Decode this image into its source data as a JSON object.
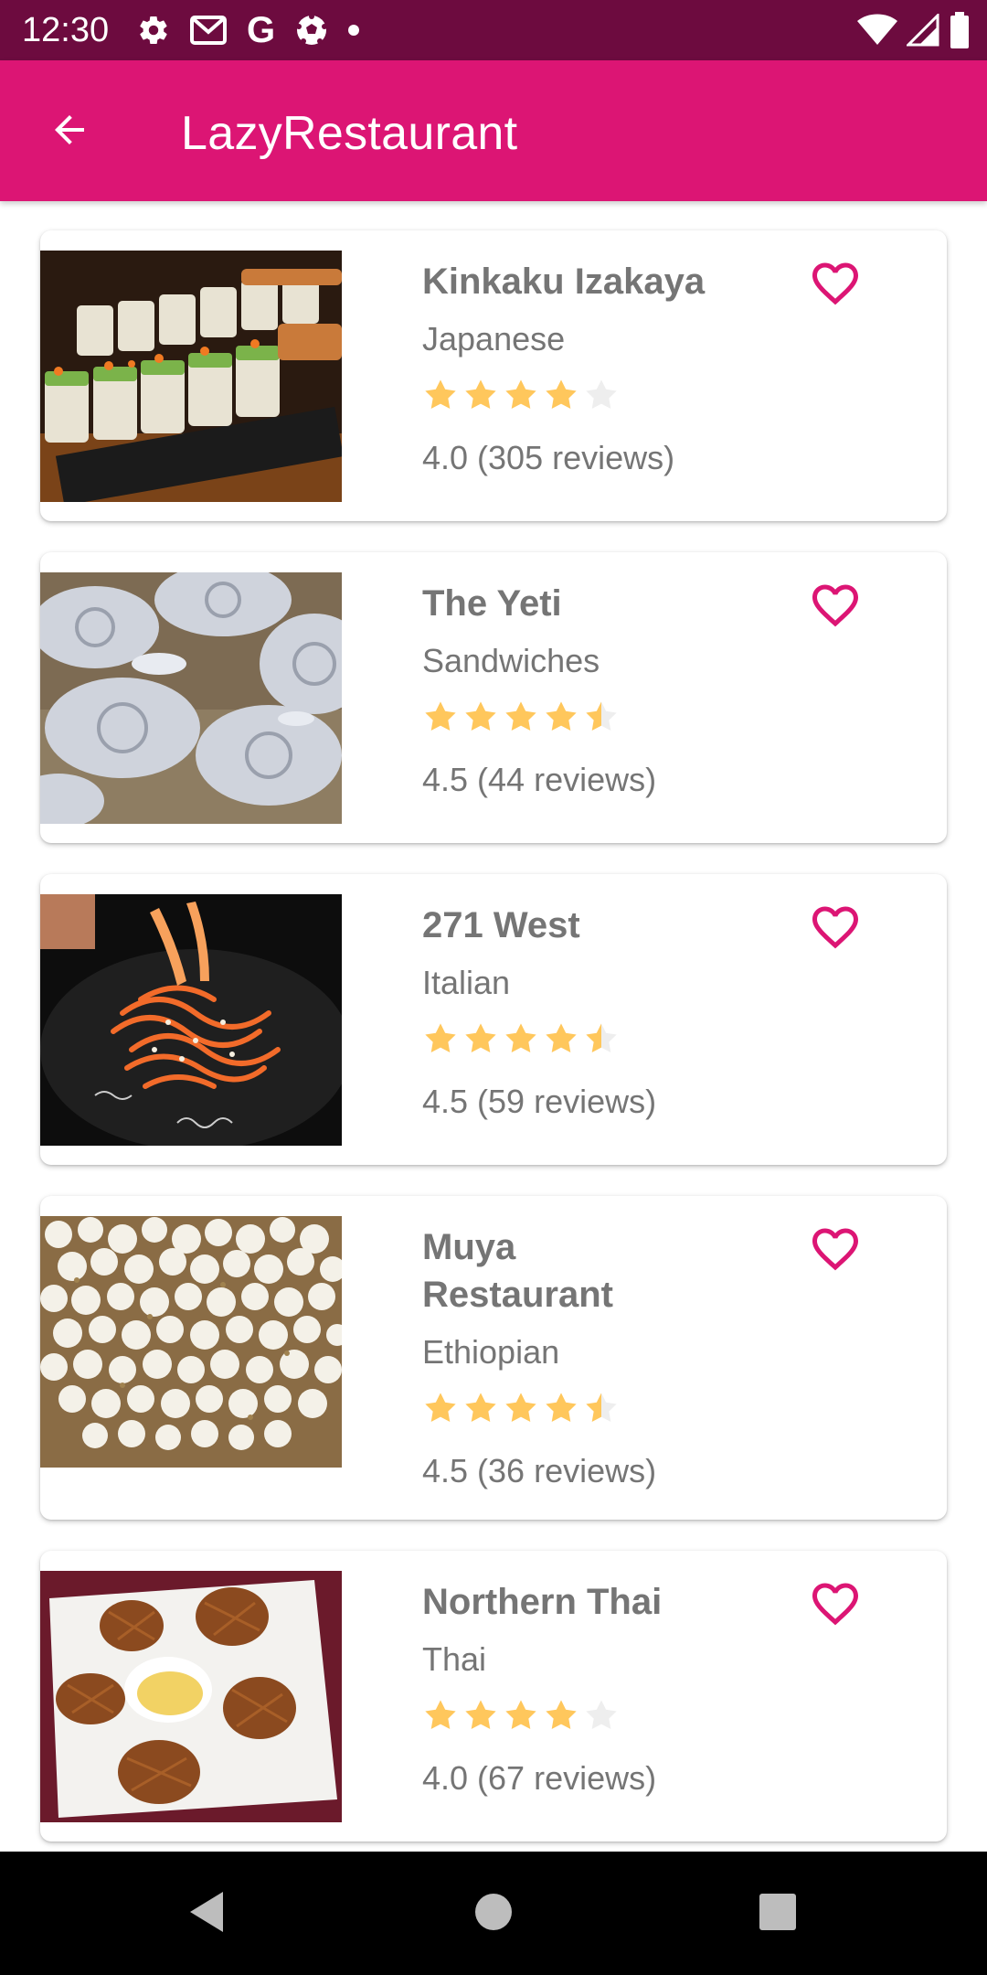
{
  "status_bar": {
    "time": "12:30",
    "left_icons": [
      "gear-icon",
      "gmail-icon",
      "google-icon",
      "soccer-ball-icon",
      "notification-dot-icon"
    ],
    "right_icons": [
      "wifi-icon",
      "signal-icon",
      "battery-icon"
    ]
  },
  "app_bar": {
    "title": "LazyRestaurant",
    "back_icon": "arrow-back-icon",
    "color": "#dc1574"
  },
  "colors": {
    "accent": "#dc1574",
    "status_bar": "#6d0b3f",
    "star_filled": "#ffc75c",
    "star_empty": "#eeeeee",
    "text_secondary": "#757575"
  },
  "restaurants": [
    {
      "name": "Kinkaku Izakaya",
      "cuisine": "Japanese",
      "rating": 4.0,
      "reviews_text": "4.0 (305 reviews)",
      "favorite_icon": "heart-outline-icon",
      "image": "sushi-rolls"
    },
    {
      "name": "The Yeti",
      "cuisine": "Sandwiches",
      "rating": 4.5,
      "reviews_text": "4.5 (44 reviews)",
      "favorite_icon": "heart-outline-icon",
      "image": "cinnamon-rolls"
    },
    {
      "name": "271 West",
      "cuisine": "Italian",
      "rating": 4.5,
      "reviews_text": "4.5 (59 reviews)",
      "favorite_icon": "heart-outline-icon",
      "image": "pasta-shrimp"
    },
    {
      "name": "Muya Restaurant",
      "cuisine": "Ethiopian",
      "rating": 4.5,
      "reviews_text": "4.5 (36 reviews)",
      "favorite_icon": "heart-outline-icon",
      "image": "popcorn"
    },
    {
      "name": "Northern Thai",
      "cuisine": "Thai",
      "rating": 4.0,
      "reviews_text": "4.0 (67 reviews)",
      "favorite_icon": "heart-outline-icon",
      "image": "fried-shrimp"
    }
  ],
  "nav_bar": {
    "icons": [
      "back-triangle-icon",
      "home-circle-icon",
      "recents-square-icon"
    ]
  }
}
